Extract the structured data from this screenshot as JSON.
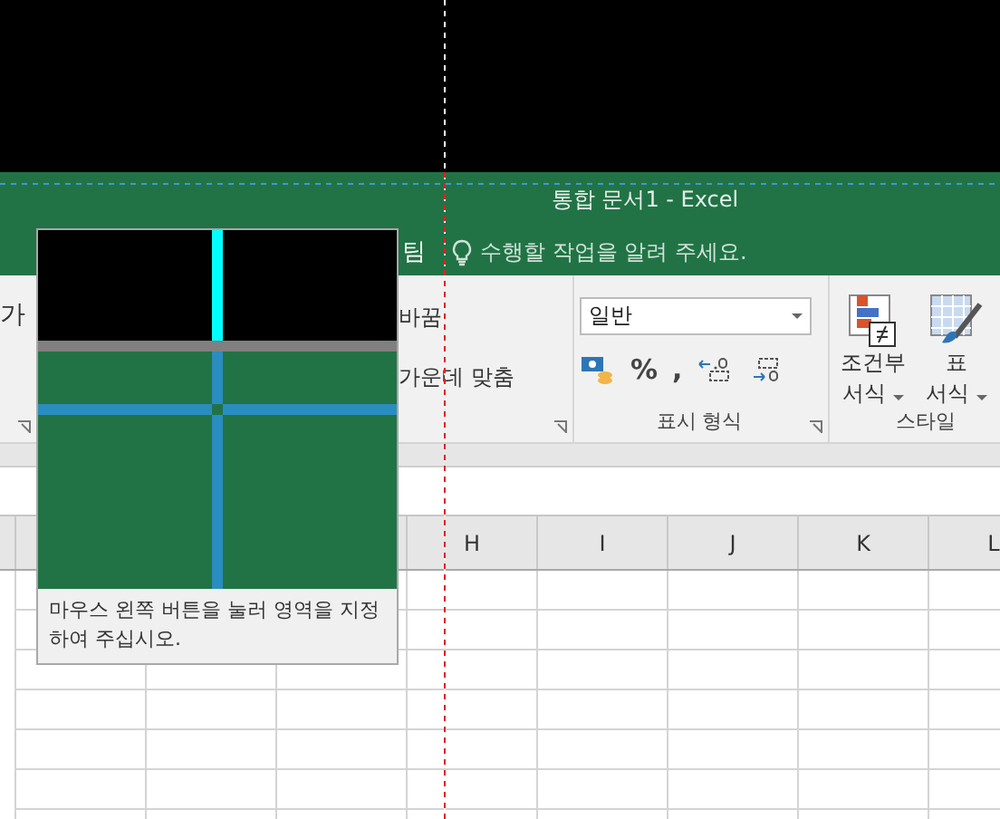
{
  "window": {
    "title": "통합 문서1 - Excel"
  },
  "ribbon_tabs": {
    "tab_fragment": "팀",
    "tell_me": "수행할 작업을 알려 주세요."
  },
  "ribbon": {
    "font_fragment": "가",
    "alignment": {
      "wrap_text": "바꿈",
      "merge_center": "가운데 맞춤"
    },
    "number": {
      "format_value": "일반",
      "percent": "%",
      "comma": ",",
      "label": "표시 형식"
    },
    "styles": {
      "buttons": [
        {
          "line_1": "조건부",
          "line_2": "서식"
        },
        {
          "line_1": "표",
          "line_2": "서식"
        }
      ],
      "label": "스타일"
    }
  },
  "sheet": {
    "columns": [
      "H",
      "I",
      "J",
      "K",
      "L"
    ]
  },
  "capture_tooltip": {
    "text": "마우스 왼쪽 버튼을 눌러 영역을 지정하여 주십시오."
  }
}
